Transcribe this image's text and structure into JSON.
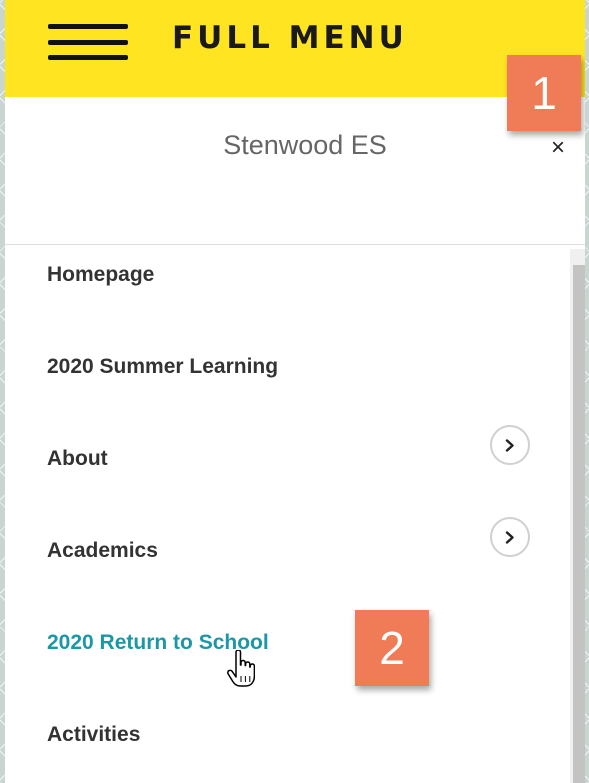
{
  "header": {
    "title": "FULL MENU",
    "icon": "hamburger-menu-icon",
    "background": "#ffe521"
  },
  "callouts": [
    "1",
    "2"
  ],
  "school": {
    "name": "Stenwood ES",
    "close_label": "×"
  },
  "nav": {
    "items": [
      {
        "label": "Homepage",
        "has_submenu": false,
        "active": false
      },
      {
        "label": "2020 Summer Learning",
        "has_submenu": false,
        "active": false
      },
      {
        "label": "About",
        "has_submenu": true,
        "active": false
      },
      {
        "label": "Academics",
        "has_submenu": true,
        "active": false
      },
      {
        "label": "2020 Return to School",
        "has_submenu": false,
        "active": true
      },
      {
        "label": "Activities",
        "has_submenu": false,
        "active": false
      }
    ],
    "active_color": "#1b98a6"
  },
  "icons": {
    "expand": "chevron-right-icon",
    "cursor": "hand-pointer-cursor-icon"
  },
  "colors": {
    "callout": "#ef7b57",
    "text": "#333333",
    "muted": "#666666"
  }
}
